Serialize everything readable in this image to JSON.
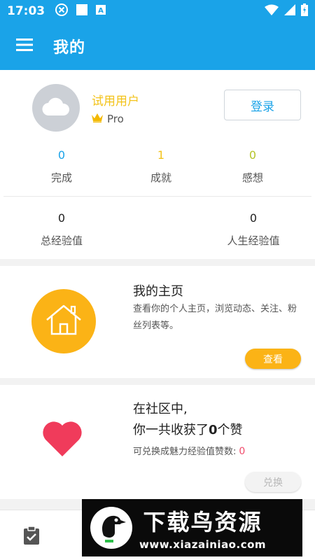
{
  "status_bar": {
    "time": "17:03",
    "left_icons": [
      "close-circle-icon",
      "square-icon",
      "a-box-icon"
    ],
    "right_icons": [
      "wifi-icon",
      "signal-icon",
      "battery-icon"
    ]
  },
  "app_bar": {
    "title": "我的",
    "menu_icon": "menu-icon",
    "color": "#1aa3e8"
  },
  "profile": {
    "name": "试用用户",
    "badge": "Pro",
    "login_label": "登录",
    "stats_row1": [
      {
        "value": "0",
        "label": "完成",
        "color": "#1aa3e8"
      },
      {
        "value": "1",
        "label": "成就",
        "color": "#f3c31a"
      },
      {
        "value": "0",
        "label": "感想",
        "color": "#b5c42a"
      }
    ],
    "stats_row2": [
      {
        "value": "0",
        "label": "总经验值"
      },
      {
        "value": "0",
        "label": "人生经验值"
      }
    ]
  },
  "homepage_card": {
    "title": "我的主页",
    "description": "查看你的个人主页，浏览动态、关注、粉丝列表等。",
    "button_label": "查看",
    "accent": "#fbb316"
  },
  "likes_card": {
    "line1": "在社区中,",
    "line2_prefix": "你一共收获了",
    "likes_count": "0",
    "line2_suffix": "个赞",
    "redeem_label": "可兑换成魅力经验值赞数:",
    "redeem_value": "0",
    "button_label": "兑换",
    "heart_color": "#f03b5b"
  },
  "watermark": {
    "text": "下载鸟资源",
    "url": "www.xiazainiao.com"
  }
}
